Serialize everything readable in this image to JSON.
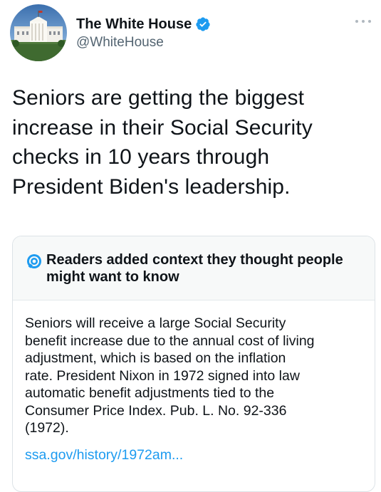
{
  "account": {
    "display_name": "The White House",
    "handle": "@WhiteHouse",
    "verified": true
  },
  "tweet": {
    "text_lines": [
      "Seniors are getting the biggest",
      "increase in their Social Security",
      "checks in 10 years through",
      "President Biden's leadership."
    ]
  },
  "community_note": {
    "title_lines": [
      "Readers added context they thought people",
      "might want to know"
    ],
    "body_lines": [
      "Seniors will receive a large Social Security",
      "benefit increase due to the annual cost of living",
      "adjustment, which is based on the inflation",
      "rate. President Nixon in 1972 signed into law",
      "automatic benefit adjustments tied to the",
      "Consumer Price Index. Pub. L. No. 92-336",
      "(1972)."
    ],
    "link_text": "ssa.gov/history/1972am..."
  },
  "icons": {
    "verified": "verified-badge-icon",
    "more": "more-options-icon",
    "note": "community-notes-icon"
  },
  "colors": {
    "accent": "#1d9bf0",
    "text": "#0f1419",
    "secondary_text": "#536471",
    "note_header_bg": "#f7f9f9"
  }
}
